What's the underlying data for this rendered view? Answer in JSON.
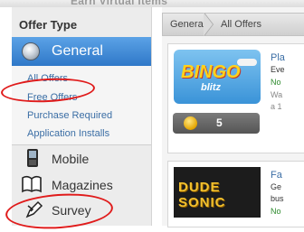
{
  "header": {
    "title": "Earn Virtual Items"
  },
  "sidebar": {
    "title": "Offer Type",
    "active": {
      "label": "General",
      "icon": "globe-icon"
    },
    "sub_items": [
      "All Offers",
      "Free Offers",
      "Purchase Required",
      "Application Installs"
    ],
    "categories": [
      {
        "label": "Mobile",
        "icon": "phone-icon"
      },
      {
        "label": "Magazines",
        "icon": "book-icon"
      },
      {
        "label": "Survey",
        "icon": "pen-icon"
      }
    ]
  },
  "breadcrumb": [
    "General",
    "All Offers"
  ],
  "offers": [
    {
      "image_text": "BINGO",
      "image_subtext": "blitz",
      "title": "Pla",
      "line1": "Eve",
      "line2": "No",
      "line3": "Wa",
      "line4": "a 1",
      "reward": "5"
    },
    {
      "image_text": "DUDE SONIC",
      "title": "Fa",
      "line1": "Ge",
      "line2": "bus",
      "line3": "No"
    }
  ],
  "colors": {
    "accent": "#2f78c8",
    "link": "#3b6ea5",
    "annotation": "#e01b1b",
    "green": "#2e8b2e"
  }
}
